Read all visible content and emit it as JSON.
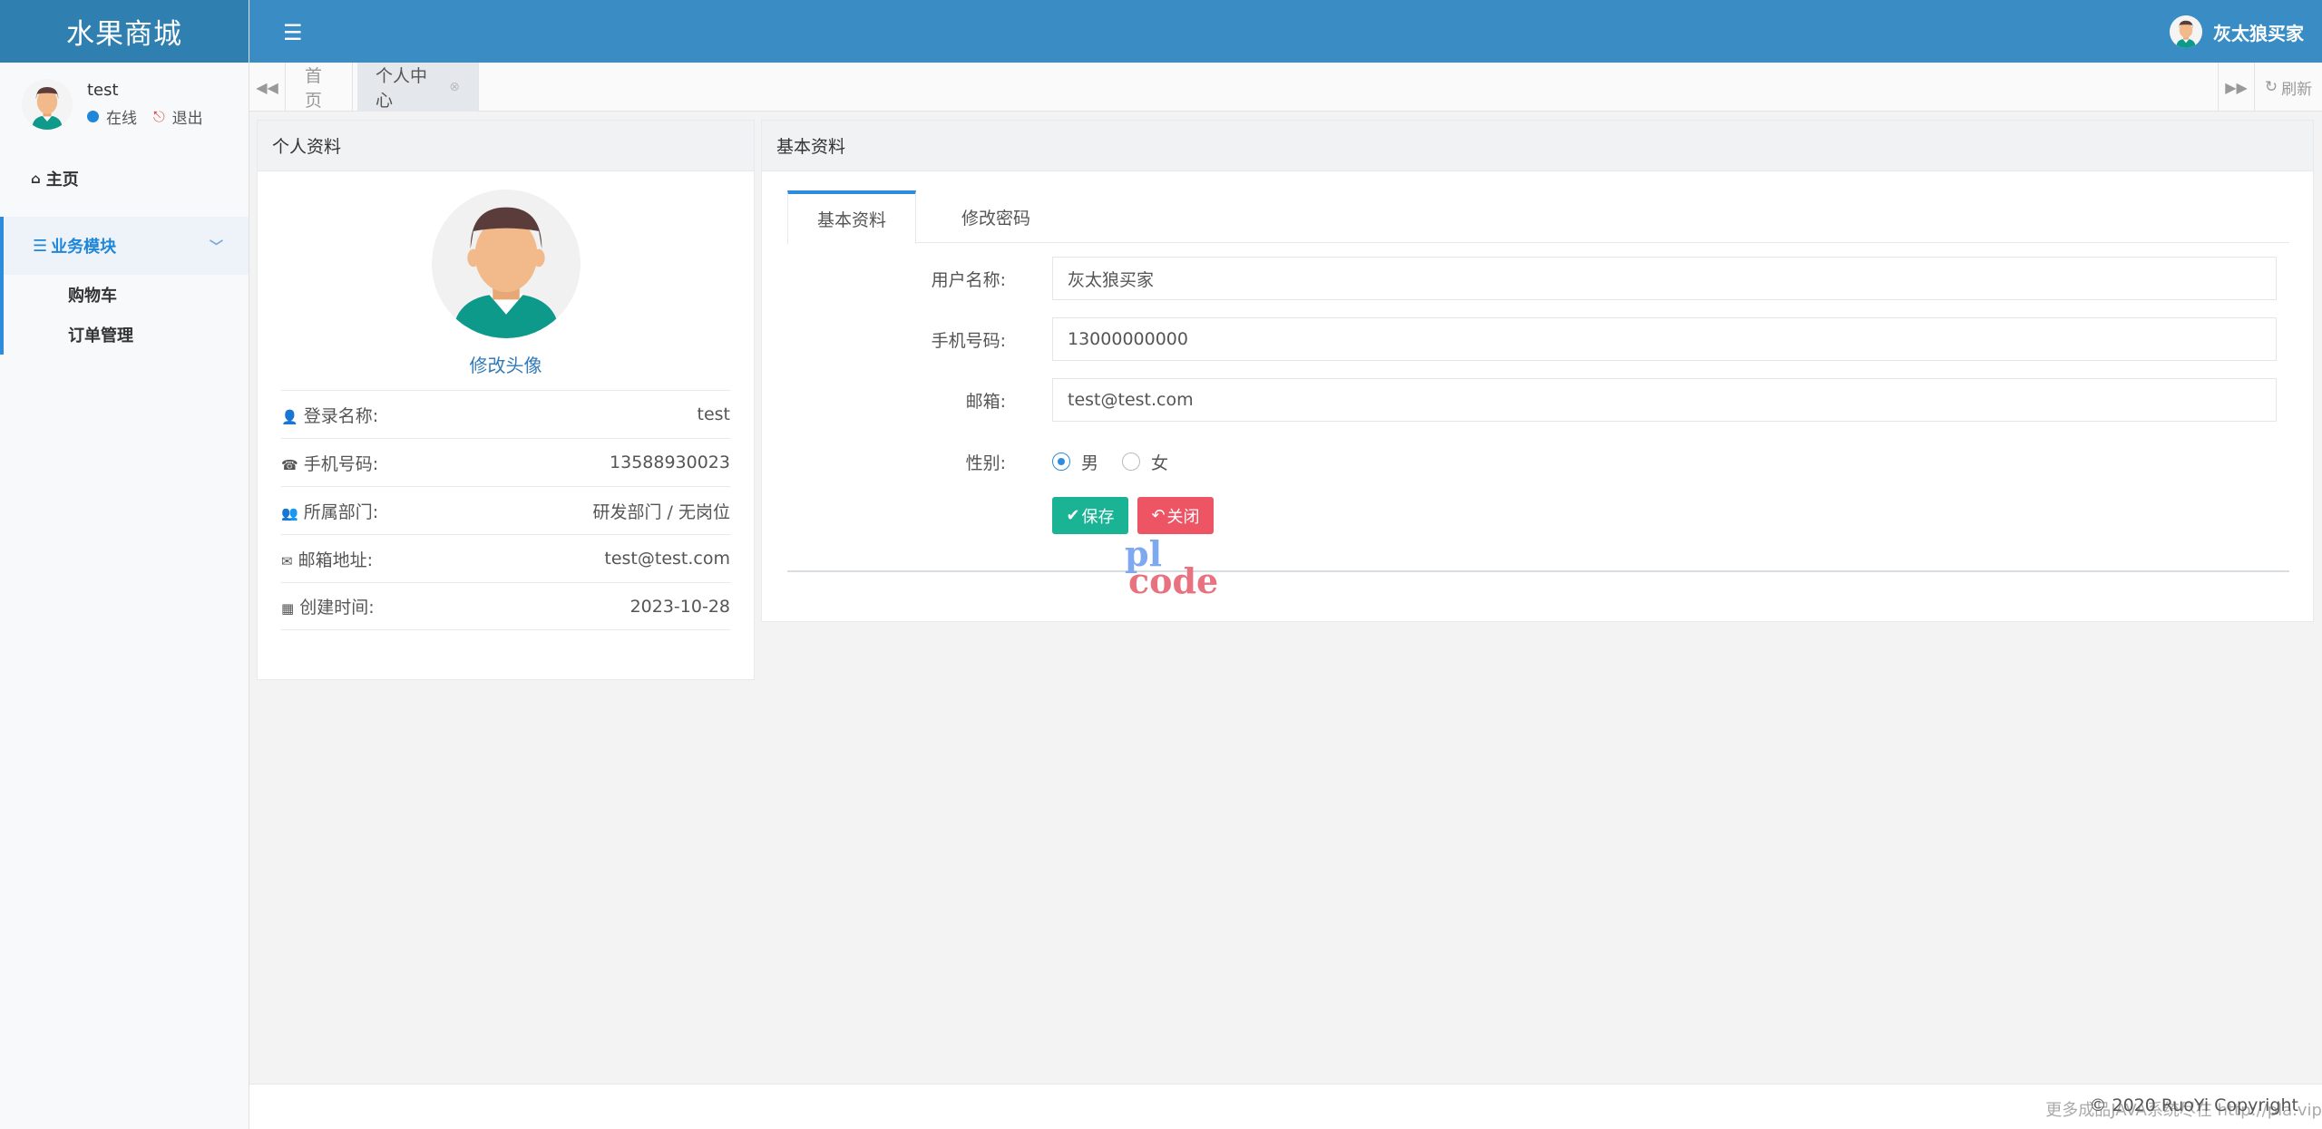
{
  "brand": "水果商城",
  "user": {
    "name": "test",
    "status": "在线",
    "logout": "退出",
    "top_name": "灰太狼买家"
  },
  "sidebar": {
    "home": "主页",
    "module": "业务模块",
    "items": [
      {
        "label": "购物车"
      },
      {
        "label": "订单管理"
      }
    ]
  },
  "tabs": {
    "home": "首页",
    "active": "个人中心",
    "refresh": "刷新"
  },
  "profile": {
    "title": "个人资料",
    "change_avatar": "修改头像",
    "rows": [
      {
        "label": "登录名称:",
        "value": "test",
        "icon": "user-icon"
      },
      {
        "label": "手机号码:",
        "value": "13588930023",
        "icon": "phone-icon"
      },
      {
        "label": "所属部门:",
        "value": "研发部门 / 无岗位",
        "icon": "users-icon"
      },
      {
        "label": "邮箱地址:",
        "value": "test@test.com",
        "icon": "envelope-icon"
      },
      {
        "label": "创建时间:",
        "value": "2023-10-28",
        "icon": "calendar-icon"
      }
    ]
  },
  "basic": {
    "title": "基本资料",
    "tab_basic": "基本资料",
    "tab_password": "修改密码",
    "username_label": "用户名称:",
    "username_value": "灰太狼买家",
    "phone_label": "手机号码:",
    "phone_value": "13000000000",
    "email_label": "邮箱:",
    "email_value": "test@test.com",
    "gender_label": "性别:",
    "gender_male": "男",
    "gender_female": "女",
    "save": "保存",
    "close": "关闭"
  },
  "watermark": {
    "top": "pl",
    "bottom": "code"
  },
  "footer": {
    "note": "更多成品JAVA系统尽在 http://pla.vip",
    "copyright": "© 2020 RuoYi Copyright"
  },
  "colors": {
    "topbar": "#3a8dc4",
    "brand": "#2f7fb0",
    "save": "#1ab394",
    "close": "#ed5565",
    "accent": "#2d8cdb"
  }
}
